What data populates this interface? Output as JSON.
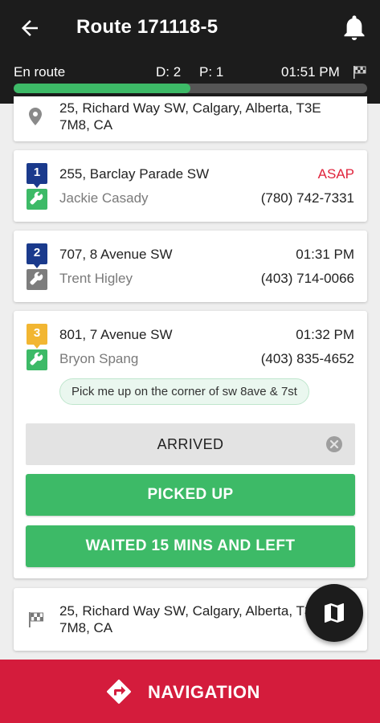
{
  "header": {
    "title": "Route 171118-5"
  },
  "status": {
    "state": "En route",
    "dropoffs": "D: 2",
    "pickups": "P: 1",
    "eta": "01:51 PM",
    "progress_fraction": 0.5
  },
  "pickup_location": {
    "address": "25, Richard Way SW, Calgary, Alberta, T3E 7M8, CA"
  },
  "stops": [
    {
      "number": "1",
      "address": "255, Barclay Parade SW",
      "time": "ASAP",
      "passenger": "Jackie Casady",
      "phone": "(780) 742-7331",
      "badge_color": "#1a3a8c",
      "icon_color": "#3dba67"
    },
    {
      "number": "2",
      "address": "707, 8 Avenue SW",
      "time": "01:31 PM",
      "passenger": "Trent Higley",
      "phone": "(403) 714-0066",
      "badge_color": "#1a3a8c",
      "icon_color": "#7d7d7d"
    },
    {
      "number": "3",
      "address": "801, 7 Avenue SW",
      "time": "01:32 PM",
      "passenger": "Bryon Spang",
      "phone": "(403) 835-4652",
      "badge_color": "#f2b632",
      "icon_color": "#3dba67",
      "note": "Pick me up on the corner of sw 8ave & 7st"
    }
  ],
  "actions": {
    "arrived": "ARRIVED",
    "picked_up": "PICKED UP",
    "waited": "WAITED 15 MINS AND LEFT"
  },
  "destination": {
    "address": "25, Richard Way SW, Calgary, Alberta, T3E 7M8, CA"
  },
  "navigation": {
    "label": "NAVIGATION"
  },
  "colors": {
    "primary_green": "#3dba67",
    "navigation_red": "#d41c3c",
    "asap_red": "#e0243c",
    "header_dark": "#1c1c1c"
  },
  "icons": [
    "back-arrow-icon",
    "bell-icon",
    "checkered-flag-icon",
    "location-pin-icon",
    "wrench-icon",
    "clear-icon",
    "map-icon",
    "navigation-turn-icon"
  ]
}
